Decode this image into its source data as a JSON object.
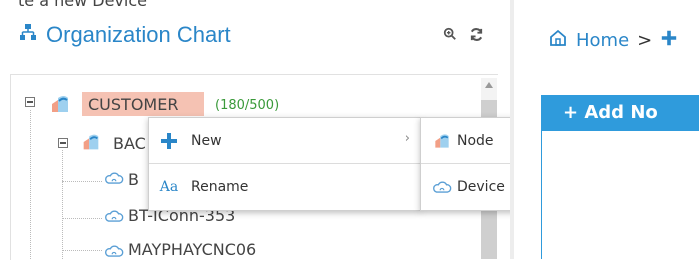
{
  "window_caption": "te a new Device",
  "panel": {
    "title": "Organization Chart"
  },
  "tree": {
    "root": {
      "label": "CUSTOMER",
      "count": "(180/500)"
    },
    "child": {
      "label": "BAC"
    },
    "leaves": [
      {
        "label": "B"
      },
      {
        "label": "BT-IConn-353"
      },
      {
        "label": "MAYPHAYCNC06"
      }
    ]
  },
  "context_menu": {
    "items": [
      {
        "label": "New",
        "icon": "plus-icon",
        "has_submenu": true
      },
      {
        "label": "Rename",
        "icon": "rename-icon"
      }
    ]
  },
  "submenu": {
    "items": [
      {
        "label": "Node",
        "icon": "node-icon"
      },
      {
        "label": "Device",
        "icon": "device-cloud-icon"
      }
    ]
  },
  "right": {
    "breadcrumb_home": "Home",
    "breadcrumb_sep": ">",
    "add_button": "+ Add No"
  },
  "colors": {
    "accent": "#2a86c8",
    "highlight": "#f5c2b3",
    "button": "#2f9bdc"
  }
}
